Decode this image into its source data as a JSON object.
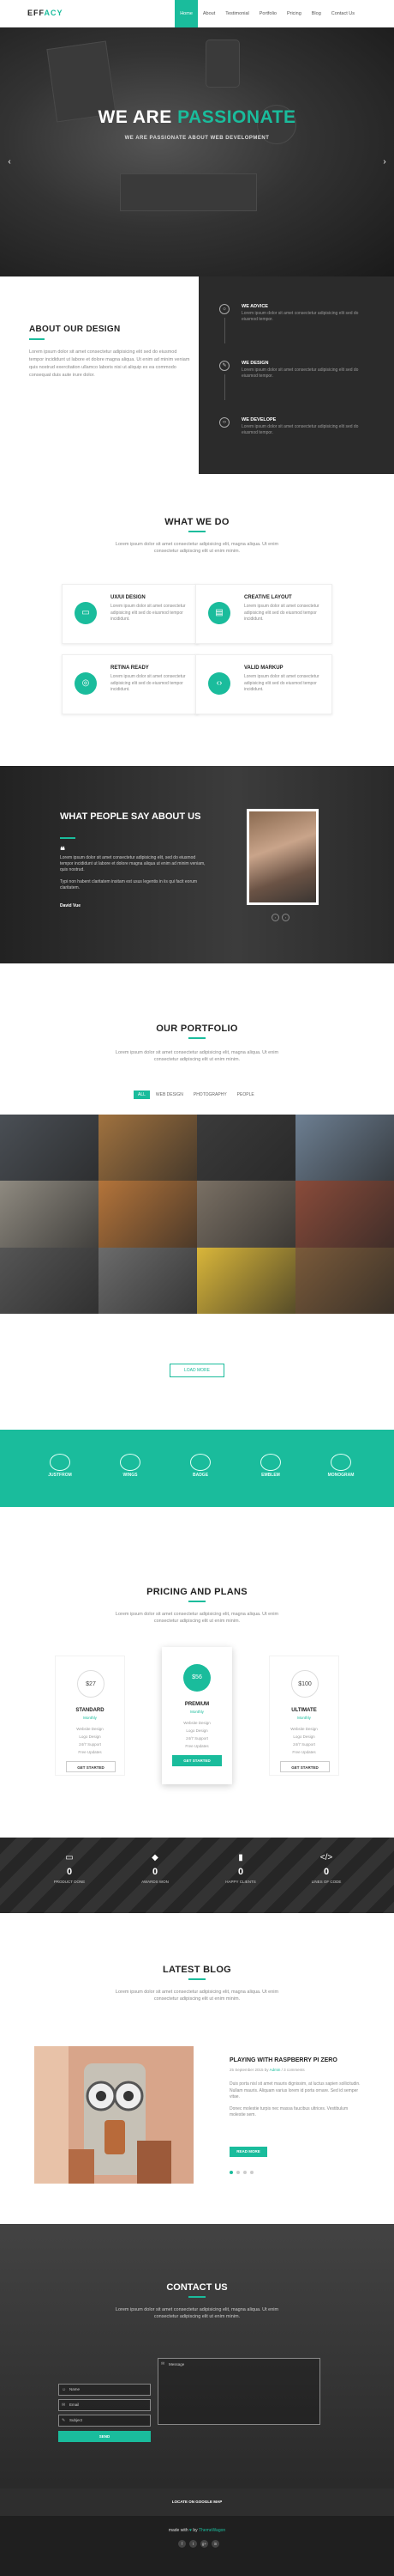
{
  "header": {
    "logo_prefix": "EFF",
    "logo_accent": "ACY",
    "nav": [
      "Home",
      "About",
      "Testimonial",
      "Portfolio",
      "Pricing",
      "Blog",
      "Contact Us"
    ]
  },
  "hero": {
    "title_white": "WE ARE",
    "title_accent": "PASSIONATE",
    "subtitle": "WE ARE PASSIONATE ABOUT WEB DEVELOPMENT",
    "prev": "‹",
    "next": "›"
  },
  "about": {
    "title": "ABOUT OUR DESIGN",
    "text": "Lorem ipsum dolor sit amet consectetur adipisicing elit sed do eiusmod tempor incididunt ut labore et dolore magna aliqua. Ut enim ad minim veniam quis nostrud exercitation ullamco laboris nisi ut aliquip ex ea commodo consequat duis aute irure dolor.",
    "features": [
      {
        "title": "WE ADVICE",
        "icon": "lightbulb-icon",
        "glyph": "☼",
        "text": "Lorem ipsum dolor sit amet consectetur adipisicing elit sed do eiusmod tempor."
      },
      {
        "title": "WE DESIGN",
        "icon": "pencil-icon",
        "glyph": "✎",
        "text": "Lorem ipsum dolor sit amet consectetur adipisicing elit sed do eiusmod tempor."
      },
      {
        "title": "WE DEVELOPE",
        "icon": "code-icon",
        "glyph": "‹›",
        "text": "Lorem ipsum dolor sit amet consectetur adipisicing elit sed do eiusmod tempor."
      }
    ]
  },
  "services": {
    "title": "WHAT WE DO",
    "subtitle": "Lorem ipsum dolor sit amet consectetur adipisicing elit, magna aliqua. Ut enim consectetur adipiscing elit ut enim minim.",
    "items": [
      {
        "title": "UX/UI DESIGN",
        "icon": "monitor-icon",
        "glyph": "▭",
        "text": "Lorem ipsum dolor sit amet consectetur adipisicing elit sed do eiusmod tempor incididunt."
      },
      {
        "title": "CREATIVE LAYOUT",
        "icon": "layout-icon",
        "glyph": "▤",
        "text": "Lorem ipsum dolor sit amet consectetur adipisicing elit sed do eiusmod tempor incididunt."
      },
      {
        "title": "RETINA READY",
        "icon": "binoculars-icon",
        "glyph": "◎",
        "text": "Lorem ipsum dolor sit amet consectetur adipisicing elit sed do eiusmod tempor incididunt."
      },
      {
        "title": "VALID MARKUP",
        "icon": "code-icon",
        "glyph": "‹›",
        "text": "Lorem ipsum dolor sit amet consectetur adipisicing elit sed do eiusmod tempor incididunt."
      }
    ]
  },
  "testimonials": {
    "title": "WHAT PEOPLE SAY ABOUT US",
    "quote_mark": "❝",
    "text1": "Lorem ipsum dolor sit amet consectetur adipisicing elit, sed do eiusmod tempor incididunt ut labore et dolore magna aliqua ut enim ad minim veniam, quis nostrud.",
    "text2": "Typi non habent claritatem insitam est usus legentis in iis qui facit eorum claritatem.",
    "author": "David Vue",
    "prev": "‹",
    "next": "›"
  },
  "portfolio": {
    "title": "OUR PORTFOLIO",
    "subtitle": "Lorem ipsum dolor sit amet consectetur adipisicing elit, magna aliqua. Ut enim consectetur adipiscing elit ut enim minim.",
    "filters": [
      "ALL",
      "WEB DESIGN",
      "PHOTOGRAPHY",
      "PEOPLE"
    ],
    "tiles": [
      "#4a4f55",
      "#a0723f",
      "#3b3b3b",
      "#6d7f92",
      "#8f8a80",
      "#b4743a",
      "#7a7064",
      "#8a4b3a",
      "#555555",
      "#6b6b6b",
      "#d9b63a",
      "#7a5a3a"
    ],
    "load_more": "LOAD MORE"
  },
  "clients": {
    "logos": [
      "JUSTFROM",
      "WINGS",
      "BADGE",
      "EMBLEM",
      "MONOGRAM"
    ]
  },
  "pricing": {
    "title": "PRICING AND PLANS",
    "subtitle": "Lorem ipsum dolor sit amet consectetur adipisicing elit, magna aliqua. Ut enim consectetur adipiscing elit ut enim minim.",
    "plans": [
      {
        "price": "$27",
        "name": "STANDARD",
        "period": "Monthly",
        "features": [
          "Website Design",
          "Logo Design",
          "24/7 Support",
          "Free Updates"
        ],
        "button": "GET STARTED"
      },
      {
        "price": "$56",
        "name": "PREMIUM",
        "period": "Monthly",
        "features": [
          "Website Design",
          "Logo Design",
          "24/7 Support",
          "Free Updates"
        ],
        "button": "GET STARTED"
      },
      {
        "price": "$100",
        "name": "ULTIMATE",
        "period": "Monthly",
        "features": [
          "Website Design",
          "Logo Design",
          "24/7 Support",
          "Free Updates"
        ],
        "button": "GET STARTED"
      }
    ]
  },
  "stats": [
    {
      "icon": "monitor-icon",
      "glyph": "▭",
      "value": "0",
      "label": "PRODUCT DONE"
    },
    {
      "icon": "cube-icon",
      "glyph": "◆",
      "value": "0",
      "label": "AWARDS WON"
    },
    {
      "icon": "chart-icon",
      "glyph": "▮",
      "value": "0",
      "label": "HAPPY CLIENTS"
    },
    {
      "icon": "code-icon",
      "glyph": "</>",
      "value": "0",
      "label": "LINES OF CODE"
    }
  ],
  "blog": {
    "title": "LATEST BLOG",
    "subtitle": "Lorem ipsum dolor sit amet consectetur adipisicing elit, magna aliqua. Ut enim consectetur adipiscing elit ut enim minim.",
    "post_title": "PLAYING WITH RASPBERRY PI ZERO",
    "meta_date": "25 September 2015",
    "meta_by": "by",
    "meta_author": "Admin",
    "meta_comments": "3 comments",
    "post_text1": "Duis porta nisl sit amet mauris dignissim, at luctus sapien sollicitudin. Nullam mauris. Aliquam varius lorem id porta ornare. Sed id semper vitae.",
    "post_text2": "Donec molestie turpis nec massa faucibus ultrices. Vestibulum molestie sem.",
    "button": "READ MORE"
  },
  "contact": {
    "title": "CONTACT US",
    "subtitle": "Lorem ipsum dolor sit amet consectetur adipisicing elit, magna aliqua. Ut enim consectetur adipiscing elit ut enim minim.",
    "name_placeholder": "Name",
    "email_placeholder": "Email",
    "subject_placeholder": "Subject",
    "message_placeholder": "Message",
    "send": "SEND"
  },
  "footer": {
    "map_label": "LOCATE ON GOOGLE MAP",
    "credit_prefix": "made with",
    "credit_heart": "♥",
    "credit_by": "by",
    "credit_author": "ThemeWagon",
    "socials": [
      "f",
      "t",
      "g+",
      "in"
    ]
  }
}
